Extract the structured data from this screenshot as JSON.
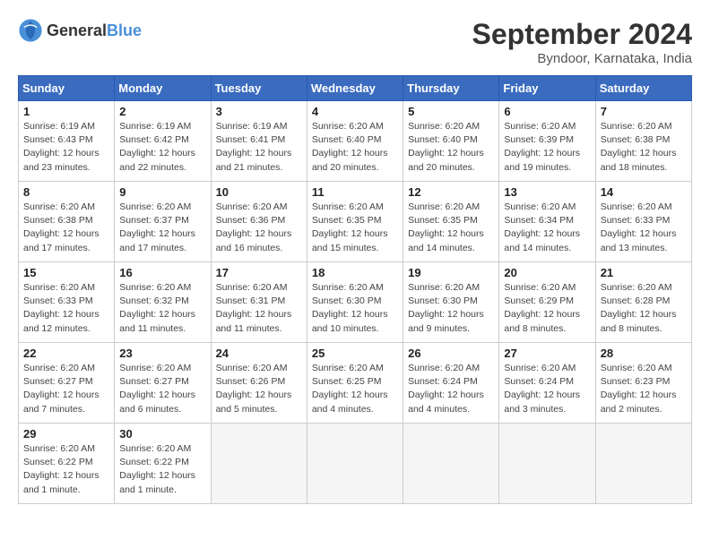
{
  "logo": {
    "general": "General",
    "blue": "Blue"
  },
  "title": {
    "month_year": "September 2024",
    "location": "Byndoor, Karnataka, India"
  },
  "weekdays": [
    "Sunday",
    "Monday",
    "Tuesday",
    "Wednesday",
    "Thursday",
    "Friday",
    "Saturday"
  ],
  "days": [
    {
      "day": "",
      "info": ""
    },
    {
      "day": "1",
      "sunrise": "6:19 AM",
      "sunset": "6:43 PM",
      "daylight": "12 hours and 23 minutes."
    },
    {
      "day": "2",
      "sunrise": "6:19 AM",
      "sunset": "6:42 PM",
      "daylight": "12 hours and 22 minutes."
    },
    {
      "day": "3",
      "sunrise": "6:19 AM",
      "sunset": "6:41 PM",
      "daylight": "12 hours and 21 minutes."
    },
    {
      "day": "4",
      "sunrise": "6:20 AM",
      "sunset": "6:40 PM",
      "daylight": "12 hours and 20 minutes."
    },
    {
      "day": "5",
      "sunrise": "6:20 AM",
      "sunset": "6:40 PM",
      "daylight": "12 hours and 20 minutes."
    },
    {
      "day": "6",
      "sunrise": "6:20 AM",
      "sunset": "6:39 PM",
      "daylight": "12 hours and 19 minutes."
    },
    {
      "day": "7",
      "sunrise": "6:20 AM",
      "sunset": "6:38 PM",
      "daylight": "12 hours and 18 minutes."
    },
    {
      "day": "8",
      "sunrise": "6:20 AM",
      "sunset": "6:38 PM",
      "daylight": "12 hours and 17 minutes."
    },
    {
      "day": "9",
      "sunrise": "6:20 AM",
      "sunset": "6:37 PM",
      "daylight": "12 hours and 17 minutes."
    },
    {
      "day": "10",
      "sunrise": "6:20 AM",
      "sunset": "6:36 PM",
      "daylight": "12 hours and 16 minutes."
    },
    {
      "day": "11",
      "sunrise": "6:20 AM",
      "sunset": "6:35 PM",
      "daylight": "12 hours and 15 minutes."
    },
    {
      "day": "12",
      "sunrise": "6:20 AM",
      "sunset": "6:35 PM",
      "daylight": "12 hours and 14 minutes."
    },
    {
      "day": "13",
      "sunrise": "6:20 AM",
      "sunset": "6:34 PM",
      "daylight": "12 hours and 14 minutes."
    },
    {
      "day": "14",
      "sunrise": "6:20 AM",
      "sunset": "6:33 PM",
      "daylight": "12 hours and 13 minutes."
    },
    {
      "day": "15",
      "sunrise": "6:20 AM",
      "sunset": "6:33 PM",
      "daylight": "12 hours and 12 minutes."
    },
    {
      "day": "16",
      "sunrise": "6:20 AM",
      "sunset": "6:32 PM",
      "daylight": "12 hours and 11 minutes."
    },
    {
      "day": "17",
      "sunrise": "6:20 AM",
      "sunset": "6:31 PM",
      "daylight": "12 hours and 11 minutes."
    },
    {
      "day": "18",
      "sunrise": "6:20 AM",
      "sunset": "6:30 PM",
      "daylight": "12 hours and 10 minutes."
    },
    {
      "day": "19",
      "sunrise": "6:20 AM",
      "sunset": "6:30 PM",
      "daylight": "12 hours and 9 minutes."
    },
    {
      "day": "20",
      "sunrise": "6:20 AM",
      "sunset": "6:29 PM",
      "daylight": "12 hours and 8 minutes."
    },
    {
      "day": "21",
      "sunrise": "6:20 AM",
      "sunset": "6:28 PM",
      "daylight": "12 hours and 8 minutes."
    },
    {
      "day": "22",
      "sunrise": "6:20 AM",
      "sunset": "6:27 PM",
      "daylight": "12 hours and 7 minutes."
    },
    {
      "day": "23",
      "sunrise": "6:20 AM",
      "sunset": "6:27 PM",
      "daylight": "12 hours and 6 minutes."
    },
    {
      "day": "24",
      "sunrise": "6:20 AM",
      "sunset": "6:26 PM",
      "daylight": "12 hours and 5 minutes."
    },
    {
      "day": "25",
      "sunrise": "6:20 AM",
      "sunset": "6:25 PM",
      "daylight": "12 hours and 4 minutes."
    },
    {
      "day": "26",
      "sunrise": "6:20 AM",
      "sunset": "6:24 PM",
      "daylight": "12 hours and 4 minutes."
    },
    {
      "day": "27",
      "sunrise": "6:20 AM",
      "sunset": "6:24 PM",
      "daylight": "12 hours and 3 minutes."
    },
    {
      "day": "28",
      "sunrise": "6:20 AM",
      "sunset": "6:23 PM",
      "daylight": "12 hours and 2 minutes."
    },
    {
      "day": "29",
      "sunrise": "6:20 AM",
      "sunset": "6:22 PM",
      "daylight": "12 hours and 1 minute."
    },
    {
      "day": "30",
      "sunrise": "6:20 AM",
      "sunset": "6:22 PM",
      "daylight": "12 hours and 1 minute."
    },
    {
      "day": "",
      "info": ""
    },
    {
      "day": "",
      "info": ""
    },
    {
      "day": "",
      "info": ""
    },
    {
      "day": "",
      "info": ""
    },
    {
      "day": "",
      "info": ""
    }
  ]
}
